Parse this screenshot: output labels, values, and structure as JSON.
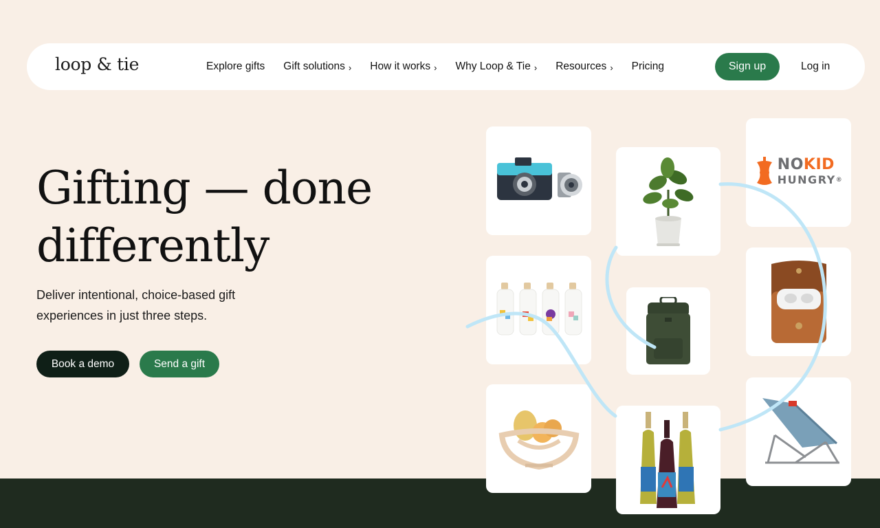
{
  "nav": {
    "logo": "loop & tie",
    "items": [
      {
        "label": "Explore gifts",
        "has_chevron": false
      },
      {
        "label": "Gift solutions",
        "has_chevron": true
      },
      {
        "label": "How it works",
        "has_chevron": true
      },
      {
        "label": "Why Loop & Tie",
        "has_chevron": true
      },
      {
        "label": "Resources",
        "has_chevron": true
      },
      {
        "label": "Pricing",
        "has_chevron": false
      }
    ],
    "chevron": "›",
    "signup": "Sign up",
    "login": "Log in"
  },
  "hero": {
    "title_line1": "Gifting — done",
    "title_line2": "differently",
    "subtitle": "Deliver intentional, choice-based gift experiences in just three steps.",
    "primary_button": "Book a demo",
    "secondary_button": "Send a gift"
  },
  "gift_cards": {
    "nokid_brand_no": "NO",
    "nokid_brand_kid": "KID",
    "nokid_brand_hungry": "HUNGRY",
    "nokid_reg": "®",
    "items": [
      "camera-icon",
      "plant-icon",
      "no-kid-hungry-logo",
      "oil-bottles-icon",
      "backpack-icon",
      "airpods-case-icon",
      "fruit-bowl-icon",
      "wine-bottles-icon",
      "camp-chair-icon"
    ]
  },
  "colors": {
    "background": "#f9efe6",
    "brand_green": "#2a7a4b",
    "dark": "#0f1f17",
    "footer": "#1f2b1f",
    "swirl": "#bfe6f7",
    "nokid_orange": "#f26b21",
    "nokid_gray": "#6d6e71"
  }
}
